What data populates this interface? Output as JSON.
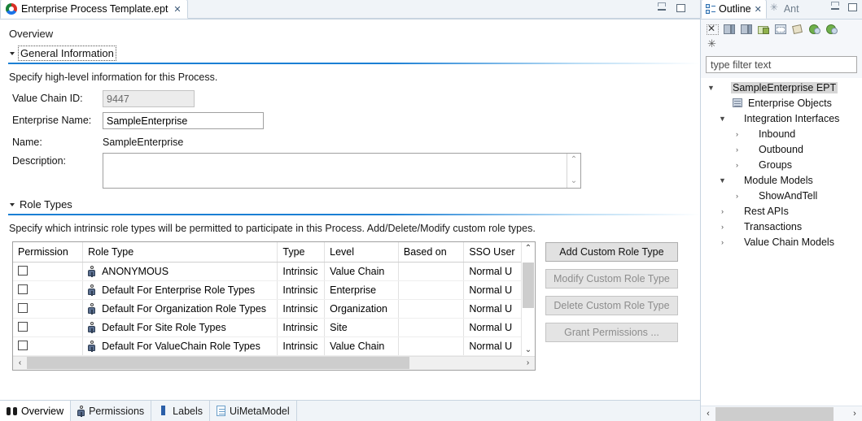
{
  "editor": {
    "tab": {
      "title": "Enterprise Process Template.ept",
      "close": "✕",
      "icon": "ept-file-icon"
    },
    "window_controls": {
      "minimize": "minimize",
      "maximize": "maximize"
    },
    "overview_label": "Overview",
    "general": {
      "section_title": "General Information",
      "description_text": "Specify high-level information for this Process.",
      "fields": {
        "value_chain_id_label": "Value Chain ID:",
        "value_chain_id_value": "9447",
        "enterprise_name_label": "Enterprise Name:",
        "enterprise_name_value": "SampleEnterprise",
        "name_label": "Name:",
        "name_value": "SampleEnterprise",
        "description_label": "Description:",
        "description_value": ""
      }
    },
    "role_types": {
      "section_title": "Role Types",
      "description_text": "Specify which intrinsic role types will be permitted to participate in this Process. Add/Delete/Modify custom role types.",
      "columns": [
        "Permission",
        "Role Type",
        "Type",
        "Level",
        "Based on",
        "SSO User"
      ],
      "rows": [
        {
          "permission": "",
          "role_type": "ANONYMOUS",
          "type": "Intrinsic",
          "level": "Value Chain",
          "based_on": "",
          "sso_user": "Normal U"
        },
        {
          "permission": "",
          "role_type": "Default For Enterprise Role Types",
          "type": "Intrinsic",
          "level": "Enterprise",
          "based_on": "",
          "sso_user": "Normal U"
        },
        {
          "permission": "",
          "role_type": "Default For Organization Role Types",
          "type": "Intrinsic",
          "level": "Organization",
          "based_on": "",
          "sso_user": "Normal U"
        },
        {
          "permission": "",
          "role_type": "Default For Site Role Types",
          "type": "Intrinsic",
          "level": "Site",
          "based_on": "",
          "sso_user": "Normal U"
        },
        {
          "permission": "",
          "role_type": "Default For ValueChain Role Types",
          "type": "Intrinsic",
          "level": "Value Chain",
          "based_on": "",
          "sso_user": "Normal U"
        }
      ],
      "buttons": [
        {
          "label": "Add Custom Role Type",
          "enabled": true
        },
        {
          "label": "Modify Custom Role Type",
          "enabled": false
        },
        {
          "label": "Delete Custom Role Type",
          "enabled": false
        },
        {
          "label": "Grant Permissions ...",
          "enabled": false
        }
      ]
    },
    "page_tabs": [
      {
        "label": "Overview",
        "icon": "binoculars-icon",
        "active": true
      },
      {
        "label": "Permissions",
        "icon": "person-icon",
        "active": false
      },
      {
        "label": "Labels",
        "icon": "label-icon",
        "active": false
      },
      {
        "label": "UiMetaModel",
        "icon": "document-icon",
        "active": false
      }
    ]
  },
  "outline": {
    "tabs": [
      {
        "label": "Outline",
        "active": true,
        "close": "✕"
      },
      {
        "label": "Ant",
        "active": false
      }
    ],
    "toolbar_row1": [
      "collapse-all-icon",
      "door-left-icon",
      "door-right-icon",
      "folder-export-icon",
      "window-icon",
      "pencil-icon",
      "globe-green-icon",
      "globe-green-alt-icon"
    ],
    "toolbar_row2": [
      "asterisk-icon"
    ],
    "filter_placeholder": "type filter text",
    "filter_value": "",
    "tree": [
      {
        "label": "SampleEnterprise EPT",
        "indent": 0,
        "arrow": "▼",
        "icon": "ept-root-icon",
        "selected": true
      },
      {
        "label": "Enterprise Objects",
        "indent": 1,
        "arrow": "",
        "icon": "enterprise-objects-icon",
        "selected": false
      },
      {
        "label": "Integration Interfaces",
        "indent": 1,
        "arrow": "▼",
        "icon": "integration-interfaces-icon",
        "selected": false
      },
      {
        "label": "Inbound",
        "indent": 2,
        "arrow": "›",
        "icon": "inbound-icon",
        "selected": false
      },
      {
        "label": "Outbound",
        "indent": 2,
        "arrow": "›",
        "icon": "outbound-icon",
        "selected": false
      },
      {
        "label": "Groups",
        "indent": 2,
        "arrow": "›",
        "icon": "groups-icon",
        "selected": false
      },
      {
        "label": "Module Models",
        "indent": 1,
        "arrow": "▼",
        "icon": "module-models-icon",
        "selected": false
      },
      {
        "label": "ShowAndTell",
        "indent": 2,
        "arrow": "›",
        "icon": "showandtell-icon",
        "selected": false
      },
      {
        "label": "Rest APIs",
        "indent": 1,
        "arrow": "›",
        "icon": "rest-apis-icon",
        "selected": false
      },
      {
        "label": "Transactions",
        "indent": 1,
        "arrow": "›",
        "icon": "transactions-icon",
        "selected": false
      },
      {
        "label": "Value Chain Models",
        "indent": 1,
        "arrow": "›",
        "icon": "value-chain-models-icon",
        "selected": false
      }
    ],
    "scroll_left": "‹",
    "scroll_right": "›"
  },
  "scroll": {
    "up": "⌃",
    "down": "⌄",
    "left": "‹",
    "right": "›"
  },
  "colors": {
    "accent": "#1b7fd4",
    "selection": "#d6d6d6",
    "disabled_text": "#8d8d8d"
  }
}
